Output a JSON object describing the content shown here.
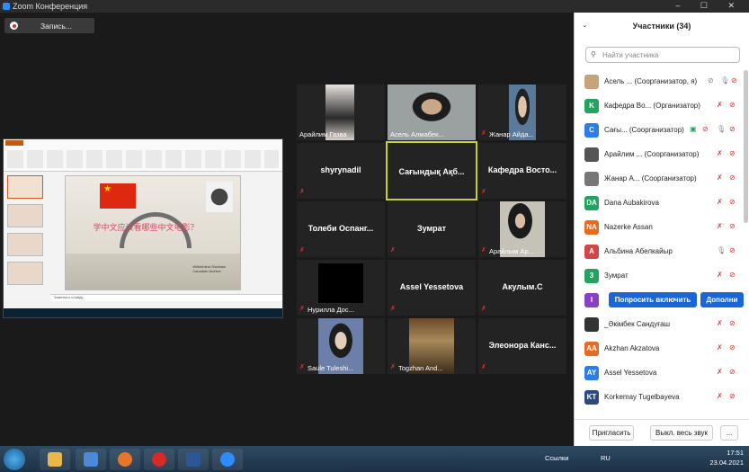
{
  "window": {
    "title": "Zoom Конференция",
    "controls": "– ☐ ✕"
  },
  "recording": {
    "label": "Запись..."
  },
  "share": {
    "slide_title": "学中文应该看哪些中文电影？",
    "slide_caption_1": "Wilhelmina Stocklaw",
    "slide_caption_2": "Canadian Archive",
    "notes_text": "Заметки к слайду"
  },
  "tiles": [
    {
      "caption": "Арайлим Газва",
      "muted": false,
      "photo": true
    },
    {
      "caption": "Асель Алмабек...",
      "muted": false,
      "photo": true
    },
    {
      "caption": "Жанар Айда...",
      "muted": true,
      "photo": true
    },
    {
      "name": "shyrynadil",
      "muted": true,
      "photo": false
    },
    {
      "name": "Сағындық Ақб...",
      "muted": false,
      "photo": false,
      "active": true
    },
    {
      "name": "Кафедра Восто...",
      "muted": true,
      "photo": false
    },
    {
      "name": "Толеби Оспанг...",
      "muted": true,
      "photo": false
    },
    {
      "name": "Зумрат",
      "muted": true,
      "photo": false
    },
    {
      "caption": "Арайлым Ар...",
      "muted": true,
      "photo": true
    },
    {
      "caption": "Нурилла Дос...",
      "muted": true,
      "photo": true
    },
    {
      "name": "Assel Yessetova",
      "muted": true,
      "photo": false
    },
    {
      "name": "Акулым.С",
      "muted": true,
      "photo": false
    },
    {
      "caption": "Saule Tuleshi...",
      "muted": true,
      "photo": true
    },
    {
      "caption": "Togzhan And...",
      "muted": true,
      "photo": true
    },
    {
      "name": "Элеонора Канс...",
      "muted": true,
      "photo": false
    }
  ],
  "participants": {
    "title": "Участники (34)",
    "search_placeholder": "Найти участника",
    "items": [
      {
        "avatar": "",
        "name": "Асель ... (Соорганизатор, я)",
        "color": "#c8a27a",
        "muted": false
      },
      {
        "avatar": "K",
        "name": "Кафедра Во... (Организатор)",
        "color": "#22a45f",
        "muted": true
      },
      {
        "avatar": "C",
        "name": "Сағы... (Соорганизатор)",
        "color": "#2b7de9",
        "muted": false
      },
      {
        "avatar": "",
        "name": "Арайлим ... (Соорганизатор)",
        "color": "#555",
        "muted": true
      },
      {
        "avatar": "",
        "name": "Жанар А... (Соорганизатор)",
        "color": "#777",
        "muted": true
      },
      {
        "avatar": "DA",
        "name": "Dana Aubakirova",
        "color": "#22a45f",
        "muted": true
      },
      {
        "avatar": "NA",
        "name": "Nazerke Assan",
        "color": "#e86a1e",
        "muted": true
      },
      {
        "avatar": "A",
        "name": "Альбина Абелкайыр",
        "color": "#d64545",
        "muted": false
      },
      {
        "avatar": "3",
        "name": "Зумрат",
        "color": "#22a45f",
        "muted": true
      },
      {
        "avatar": "I",
        "name": "",
        "color": "#8a3fc7",
        "muted": false
      },
      {
        "avatar": "",
        "name": "_Әкімбек Сандуғаш",
        "color": "#333",
        "muted": true
      },
      {
        "avatar": "AA",
        "name": "Akzhan Akzatova",
        "color": "#e86a1e",
        "muted": true
      },
      {
        "avatar": "AY",
        "name": "Assel Yessetova",
        "color": "#2b7de9",
        "muted": true
      },
      {
        "avatar": "KT",
        "name": "Korkemay Tugelbayeva",
        "color": "#2b4a80",
        "muted": true
      }
    ],
    "ask_unmute": "Попросить включить",
    "more_short": "Дополни",
    "invite": "Пригласить",
    "mute_all": "Выкл. весь звук",
    "more": "..."
  },
  "taskbar": {
    "links": "Ссылки",
    "lang": "RU",
    "time": "17:51",
    "date": "23.04.2021"
  }
}
